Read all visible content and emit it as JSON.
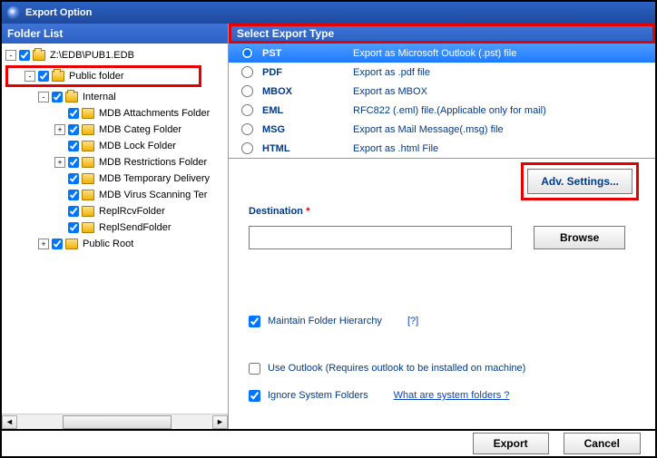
{
  "title": "Export Option",
  "left_header": "Folder List",
  "right_header": "Select Export Type",
  "tree": {
    "root": "Z:\\EDB\\PUB1.EDB",
    "pub": "Public folder",
    "int": "Internal",
    "n0": "MDB Attachments Folder",
    "n1": "MDB Categ Folder",
    "n2": "MDB Lock Folder",
    "n3": "MDB Restrictions Folder",
    "n4": "MDB Temporary Delivery",
    "n5": "MDB Virus Scanning Ter",
    "n6": "ReplRcvFolder",
    "n7": "ReplSendFolder",
    "pubroot": "Public Root"
  },
  "exports": [
    {
      "key": "PST",
      "desc": "Export as Microsoft Outlook (.pst) file",
      "selected": true
    },
    {
      "key": "PDF",
      "desc": "Export as .pdf file",
      "selected": false
    },
    {
      "key": "MBOX",
      "desc": "Export as MBOX",
      "selected": false
    },
    {
      "key": "EML",
      "desc": "RFC822 (.eml) file.(Applicable only for mail)",
      "selected": false
    },
    {
      "key": "MSG",
      "desc": "Export as Mail Message(.msg) file",
      "selected": false
    },
    {
      "key": "HTML",
      "desc": "Export as .html File",
      "selected": false
    }
  ],
  "adv_settings": "Adv. Settings...",
  "destination_label": "Destination",
  "destination_value": "",
  "browse": "Browse",
  "maintain": "Maintain Folder Hierarchy",
  "help_q": "[?]",
  "use_outlook": "Use Outlook (Requires outlook to be installed on machine)",
  "ignore_system": "Ignore System Folders",
  "what_system": "What are system folders ?",
  "export_btn": "Export",
  "cancel_btn": "Cancel"
}
